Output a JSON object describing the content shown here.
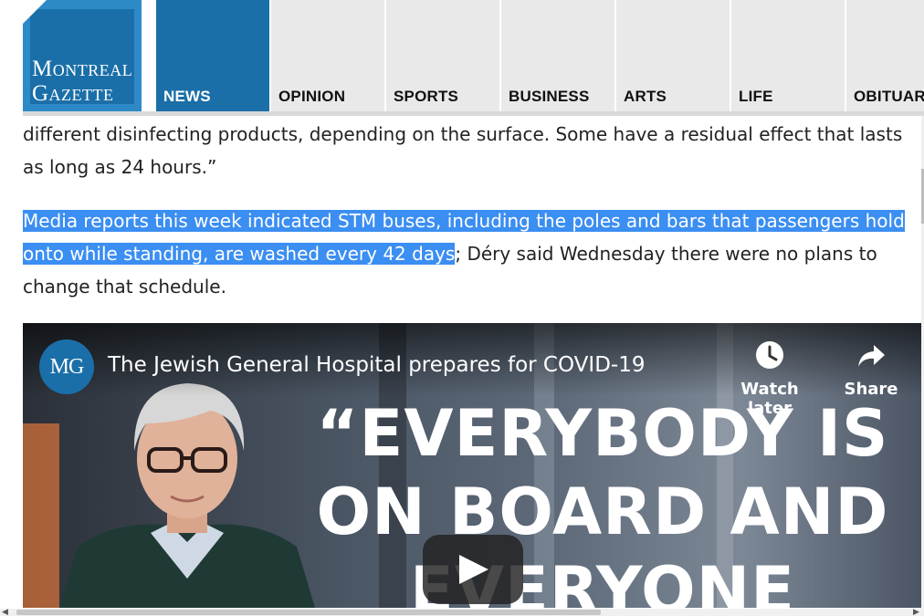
{
  "logo": {
    "line1": "Montreal",
    "line2": "Gazette"
  },
  "nav": {
    "tabs": [
      {
        "label": "NEWS",
        "active": true
      },
      {
        "label": "OPINION",
        "active": false
      },
      {
        "label": "SPORTS",
        "active": false
      },
      {
        "label": "BUSINESS",
        "active": false
      },
      {
        "label": "ARTS",
        "active": false
      },
      {
        "label": "LIFE",
        "active": false
      },
      {
        "label": "OBITUAR",
        "active": false
      }
    ]
  },
  "article": {
    "para1_line1": "different disinfecting products, depending on the surface. Some have a residual effect that lasts",
    "para1_line2": "as long as 24 hours.”",
    "para2_highlighted": "Media reports this week indicated STM buses, including the poles and bars that passengers hold onto while standing, are washed every 42 days",
    "para2_rest": "; Déry said Wednesday there were no plans to change that schedule."
  },
  "video": {
    "channel_avatar": "MG",
    "title": "The Jewish General Hospital prepares for COVID-19",
    "watch_later": "Watch later",
    "share": "Share",
    "quote_line1": "“EVERYBODY IS",
    "quote_line2": "ON BOARD AND",
    "quote_line3": "EVERYONE"
  },
  "colors": {
    "brand_blue": "#1a6fa8",
    "selection_highlight": "#3b8ef2",
    "nav_tab_bg": "#e9e9e9"
  },
  "icons": [
    "clock-icon",
    "share-arrow-icon",
    "play-icon"
  ]
}
